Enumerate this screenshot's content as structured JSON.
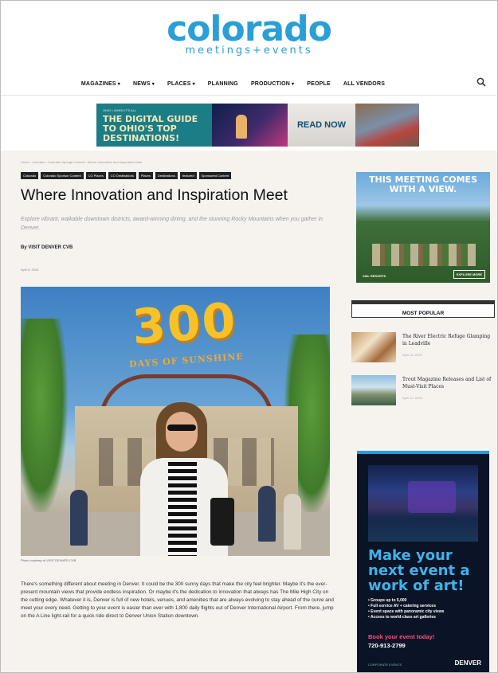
{
  "header": {
    "logo_main": "colorado",
    "logo_sub": "meetings+events",
    "nav": [
      {
        "label": "MAGAZINES",
        "dropdown": true
      },
      {
        "label": "NEWS",
        "dropdown": true
      },
      {
        "label": "PLACES",
        "dropdown": true
      },
      {
        "label": "PLANNING",
        "dropdown": false
      },
      {
        "label": "PRODUCTION",
        "dropdown": true
      },
      {
        "label": "PEOPLE",
        "dropdown": false
      },
      {
        "label": "ALL VENDORS",
        "dropdown": false
      }
    ],
    "search_icon": "search-icon"
  },
  "banner_ad": {
    "small_text": "OHIO • WHEN IT'S ALL",
    "title": "THE DIGITAL GUIDE TO OHIO'S TOP DESTINATIONS!",
    "cta": "READ NOW"
  },
  "article": {
    "breadcrumb": "Home  ›  Colorado  ›  Colorado Springs Content  ›  Where Innovation and Inspiration Meet",
    "tags": [
      "Colorado",
      "Colorado Sponsor Content",
      "CO Places",
      "CO Destinations",
      "Places",
      "Destinations",
      "featured",
      "Sponsored Content"
    ],
    "title": "Where Innovation and Inspiration Meet",
    "subtitle": "Explore vibrant, walkable downtown districts, award-winning dining, and the stunning Rocky Mountains when you gather in Denver.",
    "byline": "By VISIT DENVER CVB",
    "date": "April 8, 2025",
    "hero": {
      "headline_number": "300",
      "headline_text": "DAYS OF SUNSHINE",
      "caption": "Photo courtesy of VISIT DENVER CVB"
    },
    "body": "There's something different about meeting in Denver. It could be the 300 sunny days that make the city feel brighter. Maybe it's the ever-present mountain views that provide endless inspiration. Or maybe it's the dedication to innovation that always has The Mile High City on the cutting edge. Whatever it is, Denver is full of new hotels, venues, and amenities that are always evolving to stay ahead of the curve and meet your every need. Getting to your event is easier than ever with 1,800 daily flights out of Denver International Airport. From there, jump on the A Line light-rail for a quick ride direct to Denver Union Station downtown."
  },
  "sidebar": {
    "ad1": {
      "headline": "THIS MEETING COMES WITH A VIEW.",
      "logo": "VAIL RESORTS",
      "button": "EXPLORE MORE"
    },
    "most_popular": {
      "heading": "MOST POPULAR",
      "items": [
        {
          "title": "The River Electric Refuge Glamping in Leadville",
          "date": "April 16, 2025"
        },
        {
          "title": "Trout Magazine Releases and List of Must-Visit Places",
          "date": "April 10, 2025"
        }
      ]
    },
    "ad2": {
      "headline": "Make your next event a work of art!",
      "bullets": [
        "Groups up to 5,000",
        "Full service AV + catering services",
        "Event space with panoramic city views",
        "Access to world-class art galleries"
      ],
      "book": "Book your event today!",
      "phone": "720-913-2799",
      "footer": "CORPORATE EVENTS",
      "brand": "DENVER"
    }
  }
}
